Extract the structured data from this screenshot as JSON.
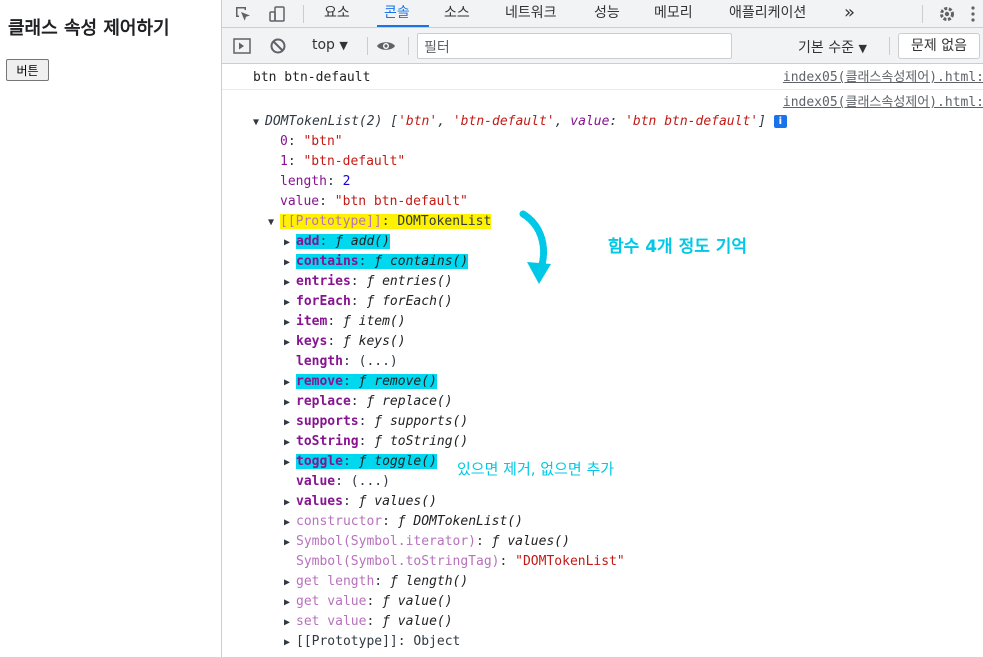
{
  "page": {
    "heading": "클래스 속성 제어하기",
    "button_label": "버튼"
  },
  "devtools": {
    "tabs": [
      "요소",
      "콘솔",
      "소스",
      "네트워크",
      "성능",
      "메모리",
      "애플리케이션"
    ],
    "more_tabs": "»",
    "active_tab": "콘솔",
    "accent_color": "#1a73e8",
    "toolbar": {
      "context": "top",
      "filter_placeholder": "필터",
      "levels": "기본 수준",
      "issues": "문제 없음"
    }
  },
  "console": {
    "log1": {
      "text": "btn btn-default",
      "source": "index05(클래스속성제어).html:"
    },
    "log2": {
      "source": "index05(클래스속성제어).html:",
      "summary_type": "DOMTokenList(2)",
      "summary_open": " [",
      "summary_v1": "'btn'",
      "summary_comma1": ", ",
      "summary_v2": "'btn-default'",
      "summary_comma2": ", ",
      "summary_vkey": "value",
      "summary_colon": ": ",
      "summary_vval": "'btn btn-default'",
      "summary_close": "]",
      "info_icon": "i",
      "entries": [
        {
          "key": "0",
          "value": "\"btn\""
        },
        {
          "key": "1",
          "value": "\"btn-default\""
        },
        {
          "key": "length",
          "value": "2"
        },
        {
          "key": "value",
          "value": "\"btn btn-default\""
        }
      ],
      "prototype_label": "[[Prototype]]",
      "prototype_value": "DOMTokenList",
      "proto_members": [
        {
          "key": "add",
          "value": "add()",
          "func": true,
          "bold": true,
          "highlight": true
        },
        {
          "key": "contains",
          "value": "contains()",
          "func": true,
          "bold": true,
          "highlight": true
        },
        {
          "key": "entries",
          "value": "entries()",
          "func": true,
          "bold": true
        },
        {
          "key": "forEach",
          "value": "forEach()",
          "func": true,
          "bold": true
        },
        {
          "key": "item",
          "value": "item()",
          "func": true,
          "bold": true
        },
        {
          "key": "keys",
          "value": "keys()",
          "func": true,
          "bold": true
        },
        {
          "key": "length",
          "value": "(...)",
          "getter": true,
          "bold": true
        },
        {
          "key": "remove",
          "value": "remove()",
          "func": true,
          "bold": true,
          "highlight": true
        },
        {
          "key": "replace",
          "value": "replace()",
          "func": true,
          "bold": true
        },
        {
          "key": "supports",
          "value": "supports()",
          "func": true,
          "bold": true
        },
        {
          "key": "toString",
          "value": "toString()",
          "func": true,
          "bold": true
        },
        {
          "key": "toggle",
          "value": "toggle()",
          "func": true,
          "bold": true,
          "highlight": true
        },
        {
          "key": "value",
          "value": "(...)",
          "getter": true,
          "bold": true
        },
        {
          "key": "values",
          "value": "values()",
          "func": true,
          "bold": true
        },
        {
          "key": "constructor",
          "value": "DOMTokenList()",
          "func": true,
          "dim": true
        },
        {
          "key": "Symbol(Symbol.iterator)",
          "value": "values()",
          "func": true,
          "dim": true
        },
        {
          "key": "Symbol(Symbol.toStringTag)",
          "value": "\"DOMTokenList\"",
          "string": true,
          "dim": true,
          "noarrow": true
        },
        {
          "key": "get length",
          "value": "length()",
          "func": true,
          "dim": true
        },
        {
          "key": "get value",
          "value": "value()",
          "func": true,
          "dim": true
        },
        {
          "key": "set value",
          "value": "value()",
          "func": true,
          "dim": true
        },
        {
          "key": "[[Prototype]]",
          "value": "Object",
          "plainval": true,
          "dim": true,
          "grey": true
        }
      ],
      "func_symbol": "ƒ"
    },
    "notes": {
      "note1": "함수 4개 정도 기억",
      "note2": "있으면 제거, 없으면 추가"
    }
  }
}
